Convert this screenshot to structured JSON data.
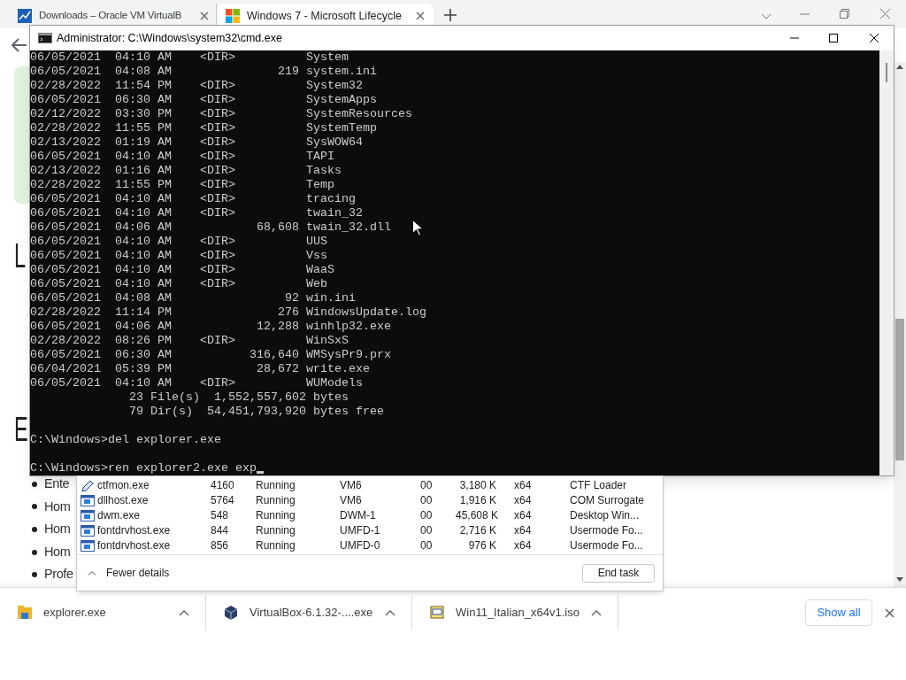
{
  "browser": {
    "tabs": [
      {
        "title": "Downloads – Oracle VM VirtualB",
        "kind": "chart",
        "selected": false
      },
      {
        "title": "Windows 7 - Microsoft Lifecycle",
        "kind": "squares",
        "selected": true
      }
    ],
    "page": {
      "headings": [
        "L",
        "E"
      ],
      "bullets": [
        "Ente",
        "Hom",
        "Hom",
        "Hom",
        "Profe"
      ]
    },
    "downloads": [
      {
        "name": "explorer.exe",
        "kind": "folder"
      },
      {
        "name": "VirtualBox-6.1.32-....exe",
        "kind": "cube"
      },
      {
        "name": "Win11_Italian_x64v1.iso",
        "kind": "disc"
      }
    ],
    "show_all": "Show all"
  },
  "console_window": {
    "title": "Administrator: C:\\Windows\\system32\\cmd.exe",
    "listing": [
      "06/05/2021  04:10 AM    <DIR>          System",
      "06/05/2021  04:08 AM               219 system.ini",
      "02/28/2022  11:54 PM    <DIR>          System32",
      "06/05/2021  06:30 AM    <DIR>          SystemApps",
      "02/12/2022  03:30 PM    <DIR>          SystemResources",
      "02/28/2022  11:55 PM    <DIR>          SystemTemp",
      "02/13/2022  01:19 AM    <DIR>          SysWOW64",
      "06/05/2021  04:10 AM    <DIR>          TAPI",
      "02/13/2022  01:16 AM    <DIR>          Tasks",
      "02/28/2022  11:55 PM    <DIR>          Temp",
      "06/05/2021  04:10 AM    <DIR>          tracing",
      "06/05/2021  04:10 AM    <DIR>          twain_32",
      "06/05/2021  04:06 AM            68,608 twain_32.dll",
      "06/05/2021  04:10 AM    <DIR>          UUS",
      "06/05/2021  04:10 AM    <DIR>          Vss",
      "06/05/2021  04:10 AM    <DIR>          WaaS",
      "06/05/2021  04:10 AM    <DIR>          Web",
      "06/05/2021  04:08 AM                92 win.ini",
      "02/28/2022  11:14 PM               276 WindowsUpdate.log",
      "06/05/2021  04:06 AM            12,288 winhlp32.exe",
      "02/28/2022  08:26 PM    <DIR>          WinSxS",
      "06/05/2021  06:30 AM           316,640 WMSysPr9.prx",
      "06/04/2021  05:39 PM            28,672 write.exe",
      "06/05/2021  04:10 AM    <DIR>          WUModels"
    ],
    "summary": [
      "              23 File(s)  1,552,557,602 bytes",
      "              79 Dir(s)  54,451,793,920 bytes free"
    ],
    "commands": [
      "C:\\Windows>del explorer.exe",
      "C:\\Windows>ren explorer2.exe exp"
    ],
    "cursor": true
  },
  "task_manager": {
    "processes": [
      {
        "name": "ctfmon.exe",
        "kind": "pen",
        "pid": "4160",
        "status": "Running",
        "user": "VM6",
        "cpu": "00",
        "memory": "3,180 K",
        "arch": "x64",
        "description": "CTF Loader"
      },
      {
        "name": "dllhost.exe",
        "kind": "window",
        "pid": "5764",
        "status": "Running",
        "user": "VM6",
        "cpu": "00",
        "memory": "1,916 K",
        "arch": "x64",
        "description": "COM Surrogate"
      },
      {
        "name": "dwm.exe",
        "kind": "window",
        "pid": "548",
        "status": "Running",
        "user": "DWM-1",
        "cpu": "00",
        "memory": "45,608 K",
        "arch": "x64",
        "description": "Desktop Win..."
      },
      {
        "name": "fontdrvhost.exe",
        "kind": "window",
        "pid": "844",
        "status": "Running",
        "user": "UMFD-1",
        "cpu": "00",
        "memory": "2,716 K",
        "arch": "x64",
        "description": "Usermode Fo..."
      },
      {
        "name": "fontdrvhost.exe",
        "kind": "window",
        "pid": "856",
        "status": "Running",
        "user": "UMFD-0",
        "cpu": "00",
        "memory": "976 K",
        "arch": "x64",
        "description": "Usermode Fo..."
      }
    ],
    "fewer_details": "Fewer details",
    "end_task": "End task"
  }
}
